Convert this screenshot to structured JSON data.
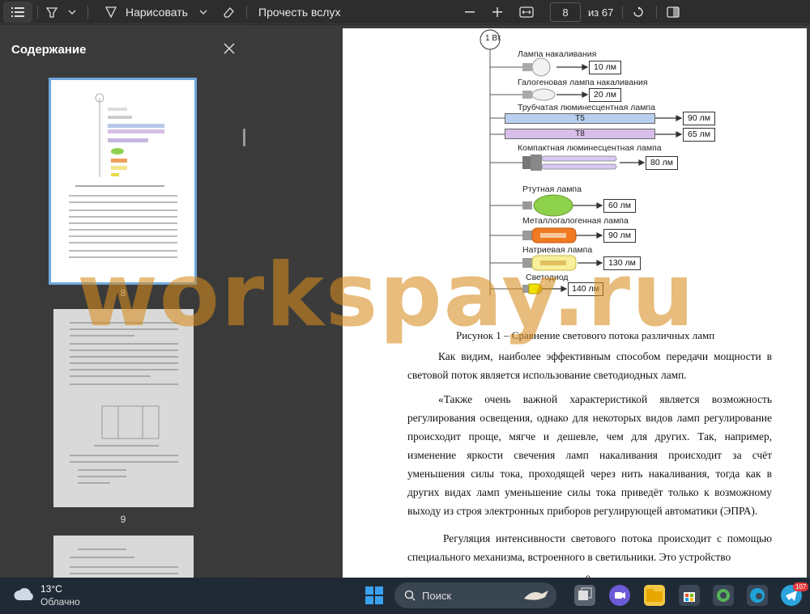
{
  "toolbar": {
    "draw_label": "Нарисовать",
    "read_aloud_label": "Прочесть вслух",
    "page_current": "8",
    "page_total": "из 67"
  },
  "sidebar": {
    "title": "Содержание",
    "thumbnails": [
      {
        "page": "8"
      },
      {
        "page": "9"
      }
    ]
  },
  "diagram": {
    "power": "1 Вт",
    "lamps": [
      {
        "name": "Лампа накаливания",
        "lumens": "10 лм"
      },
      {
        "name": "Галогеновая лампа накаливания",
        "lumens": "20 лм"
      },
      {
        "name": "Трубчатая люминесцентная лампа",
        "tubes": [
          {
            "label": "T5",
            "lumens": "90 лм"
          },
          {
            "label": "T8",
            "lumens": "65 лм"
          }
        ]
      },
      {
        "name": "Компактная люминесцентная лампа",
        "lumens": "80 лм"
      },
      {
        "name": "Ртутная лампа",
        "lumens": "60 лм"
      },
      {
        "name": "Металлогалогенная лампа",
        "lumens": "90 лм"
      },
      {
        "name": "Натриевая лампа",
        "lumens": "130 лм"
      },
      {
        "name": "Светодиод",
        "lumens": "140 лм"
      }
    ]
  },
  "document": {
    "caption": "Рисунок 1 – Сравнение светового потока различных ламп",
    "para1": "Как видим, наиболее эффективным способом передачи мощности в световой поток является использование светодиодных ламп.",
    "para2": "«Также очень важной характеристикой является возможность регулирования освещения, однако для некоторых видов ламп регулирование происходит проще, мягче и дешевле, чем для других. Так, например, изменение яркости свечения ламп накаливания происходит за счёт уменьшения силы тока, проходящей через нить накаливания, тогда как в других видах ламп уменьшение силы тока приведёт только к возможному выходу из строя электронных приборов регулирующей автоматики (ЭПРА).",
    "para3": "Регуляция интенсивности светового потока происходит с помощью специального механизма, встроенного в светильники. Это устройство",
    "page_number": "8"
  },
  "watermark": "workspay.ru",
  "taskbar": {
    "temperature": "13°C",
    "weather": "Облачно",
    "search_placeholder": "Поиск",
    "badge": "107"
  }
}
